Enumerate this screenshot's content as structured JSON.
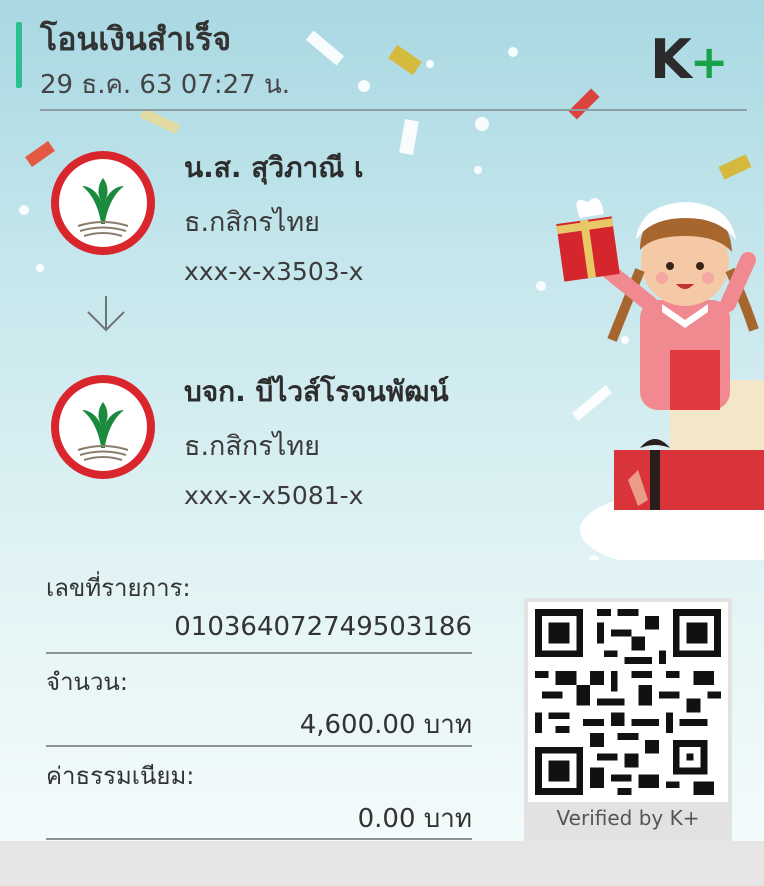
{
  "header": {
    "title": "โอนเงินสำเร็จ",
    "datetime": "29 ธ.ค. 63  07:27 น.",
    "logo_k": "K",
    "logo_plus": "+"
  },
  "sender": {
    "name": "น.ส. สุวิภาณี เ",
    "bank": "ธ.กสิกรไทย",
    "account": "xxx-x-x3503-x"
  },
  "receiver": {
    "name": "บจก. บีไวส์โรจนพัฒน์",
    "bank": "ธ.กสิกรไทย",
    "account": "xxx-x-x5081-x"
  },
  "details": {
    "ref_label": "เลขที่รายการ:",
    "ref_value": "010364072749503186",
    "amount_label": "จำนวน:",
    "amount_value": "4,600.00 บาท",
    "fee_label": "ค่าธรรมเนียม:",
    "fee_value": "0.00 บาท"
  },
  "qr": {
    "verified_text": "Verified by K+"
  },
  "colors": {
    "accent": "#2bbf8f",
    "kbank_green": "#1a8a3c",
    "logo_plus": "#17a34a",
    "ring_red": "#d9262c"
  },
  "icons": {
    "bank_logo": "kasikorn-bank-icon",
    "arrow": "arrow-down-icon",
    "qr": "qr-code-icon",
    "decor": "christmas-girl-illustration"
  }
}
